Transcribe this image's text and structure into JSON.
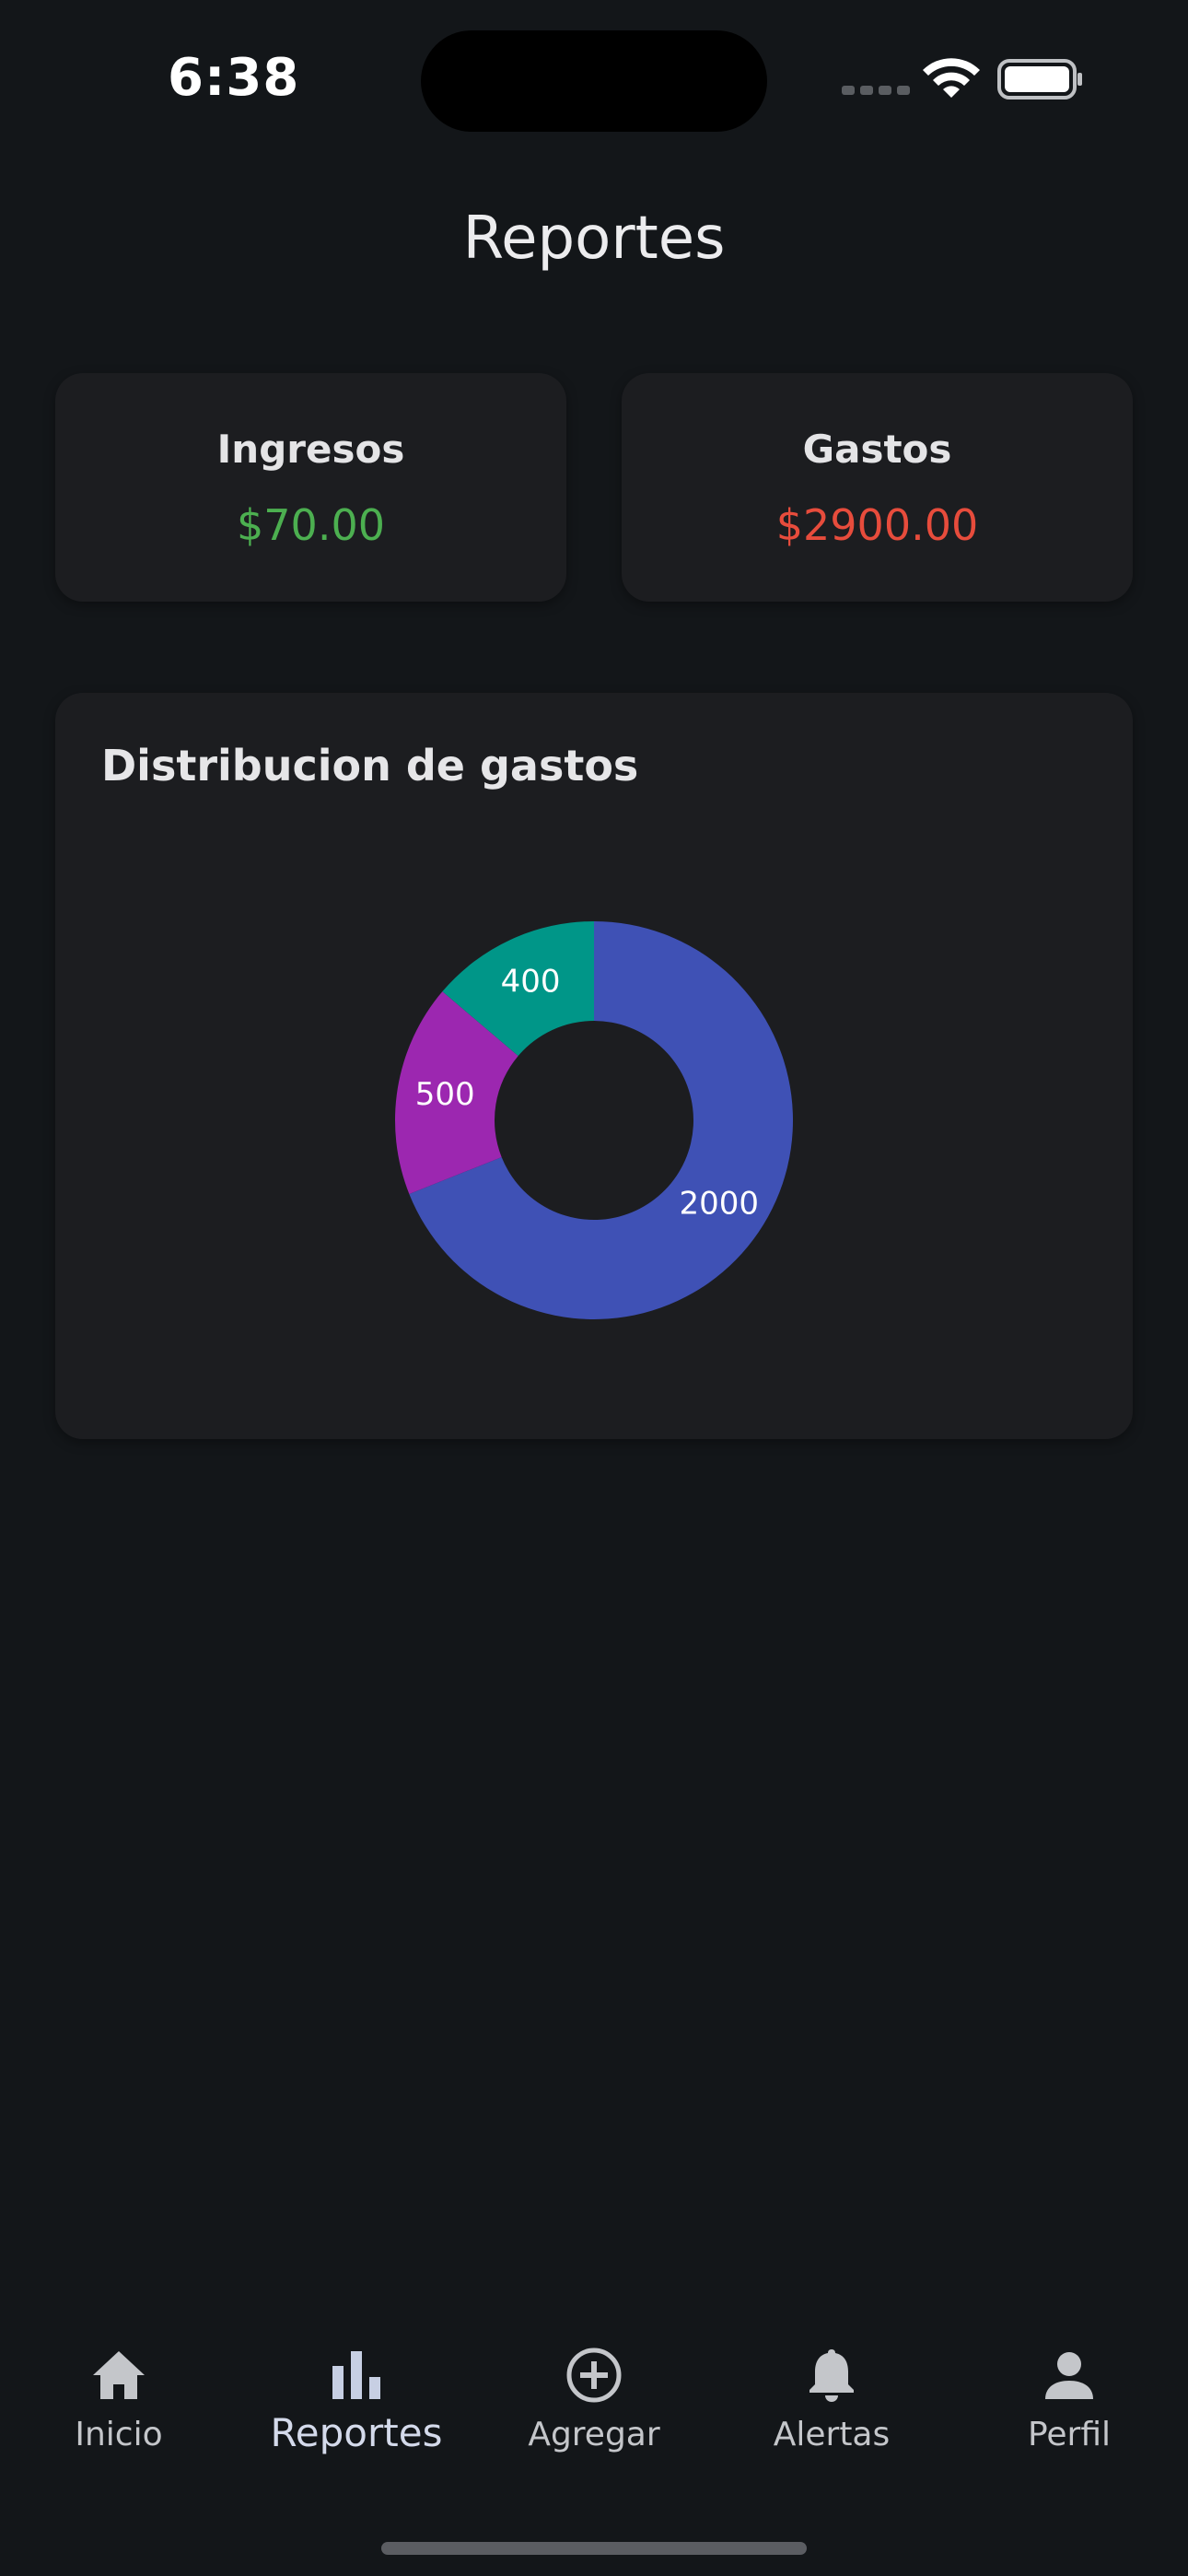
{
  "status_bar": {
    "time": "6:38"
  },
  "header": {
    "title": "Reportes"
  },
  "summary": {
    "income": {
      "label": "Ingresos",
      "value": "$70.00",
      "color": "#4caf50"
    },
    "expenses": {
      "label": "Gastos",
      "value": "$2900.00",
      "color": "#e74c3c"
    }
  },
  "chart_card": {
    "title": "Distribucion de gastos"
  },
  "chart_data": {
    "type": "pie",
    "title": "Distribucion de gastos",
    "donut": true,
    "values": [
      2000,
      500,
      400
    ],
    "labels": [
      "2000",
      "500",
      "400"
    ],
    "colors": [
      "#3f51b5",
      "#9c27b0",
      "#009688"
    ]
  },
  "bottom_nav": {
    "items": [
      {
        "label": "Inicio",
        "icon": "home-icon",
        "active": false
      },
      {
        "label": "Reportes",
        "icon": "bar-chart-icon",
        "active": true
      },
      {
        "label": "Agregar",
        "icon": "add-circle-icon",
        "active": false
      },
      {
        "label": "Alertas",
        "icon": "bell-icon",
        "active": false
      },
      {
        "label": "Perfil",
        "icon": "person-icon",
        "active": false
      }
    ]
  }
}
